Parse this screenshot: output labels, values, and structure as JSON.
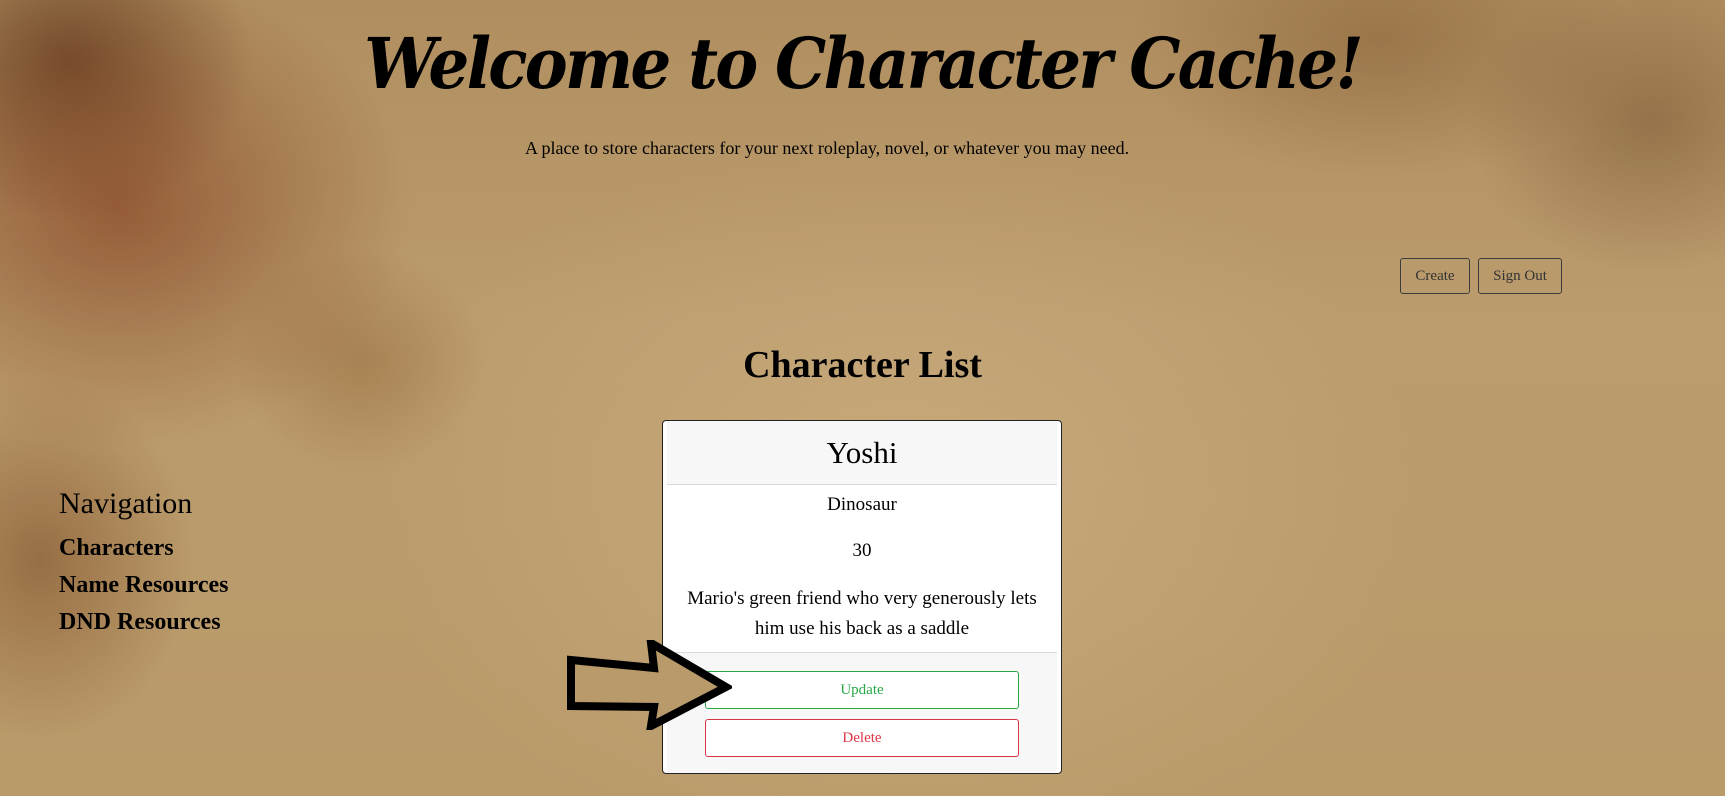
{
  "header": {
    "title": "Welcome to Character Cache!",
    "subtitle": "A place to store characters for your next roleplay, novel, or whatever you may need."
  },
  "actions": {
    "create_label": "Create",
    "signout_label": "Sign Out"
  },
  "main": {
    "heading": "Character List",
    "card": {
      "name": "Yoshi",
      "species": "Dinosaur",
      "age": "30",
      "description": "Mario's green friend who very generously lets him use his back as a saddle",
      "update_label": "Update",
      "delete_label": "Delete"
    }
  },
  "nav": {
    "heading": "Navigation",
    "items": [
      {
        "label": "Characters"
      },
      {
        "label": "Name Resources"
      },
      {
        "label": "DND Resources"
      }
    ]
  },
  "colors": {
    "update": "#28a745",
    "delete": "#dc3545"
  }
}
